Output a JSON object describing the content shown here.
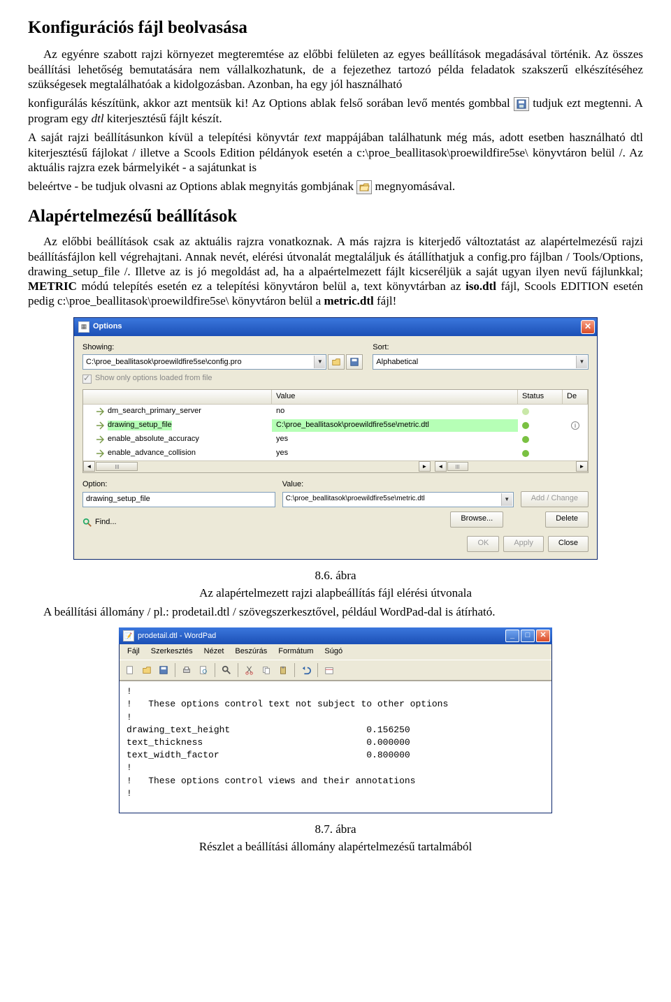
{
  "doc": {
    "h1": "Konfigurációs fájl beolvasása",
    "p1a": "Az egyénre szabott rajzi környezet megteremtése az előbbi felületen az egyes beállítások megadásával történik. Az összes beállítási lehetőség bemutatására nem vállalkozhatunk, de a fejezethez tartozó példa feladatok szakszerű elkészítéséhez szükségesek megtalálhatóak a kidolgozásban. Azonban, ha egy jól használható",
    "p1b_pre": "konfigurálás készítünk, akkor azt mentsük ki! Az Options ablak felső sorában levő mentés gombbal ",
    "p1b_post": " tudjuk ezt megtenni. A program egy ",
    "p1b_it": "dtl",
    "p1b_end": " kiterjesztésű fájlt készít.",
    "p2_pre": "A saját rajzi beállításunkon kívül a telepítési könyvtár ",
    "p2_it1": "text",
    "p2_mid1": " mappájában találhatunk még más, adott esetben használható dtl kiterjesztésű fájlokat / illetve a Scools Edition példányok esetén a c:\\proe_beallitasok\\proewildfire5se\\ könyvtáron belül /. Az aktuális rajzra ezek bármelyikét - a sajátunkat is",
    "p3_pre": "beleértve - be tudjuk olvasni az Options ablak megnyitás gombjának ",
    "p3_post": " megnyomásával.",
    "h2": "Alapértelmezésű beállítások",
    "p4_pre": "Az előbbi beállítások csak az aktuális rajzra vonatkoznak. A más rajzra is kiterjedő változtatást az alapértelmezésű rajzi beállításfájlon kell végrehajtani. Annak nevét, elérési útvonalát megtaláljuk és átállíthatjuk a config.pro fájlban / Tools/Options, drawing_setup_file /. Illetve az is jó megoldást ad, ha a alpaértelmezett fájlt kicseréljük a saját ugyan ilyen nevű fájlunkkal; ",
    "p4_b1": "METRIC",
    "p4_mid1": " módú telepítés esetén ez a telepítési könyvtáron belül a, text könyvtárban az ",
    "p4_b2": "iso.dtl",
    "p4_mid2": " fájl, Scools EDITION esetén pedig c:\\proe_beallitasok\\proewildfire5se\\ könyvtáron belül a ",
    "p4_b3": "metric.dtl",
    "p4_end": " fájl!",
    "fig1_num": "8.6. ábra",
    "fig1_cap": "Az alapértelmezett rajzi alapbeállítás fájl elérési útvonala",
    "p5": "A beállítási állomány / pl.: prodetail.dtl / szövegszerkesztővel, például WordPad-dal is átírható.",
    "fig2_num": "8.7. ábra",
    "fig2_cap": "Részlet a beállítási állomány alapértelmezésű tartalmából"
  },
  "options": {
    "title": "Options",
    "showing_lbl": "Showing:",
    "showing_val": "C:\\proe_beallitasok\\proewildfire5se\\config.pro",
    "sort_lbl": "Sort:",
    "sort_val": "Alphabetical",
    "show_only": "Show only options loaded from file",
    "cols": {
      "c1": "",
      "c2": "Value",
      "c3": "Status",
      "c4": "De"
    },
    "rows": [
      {
        "name": "dm_search_primary_server",
        "value": "no",
        "dot": "light",
        "info": false
      },
      {
        "name": "drawing_setup_file",
        "value": "C:\\proe_beallitasok\\proewildfire5se\\metric.dtl",
        "dot": "dark",
        "info": true,
        "selected": true
      },
      {
        "name": "enable_absolute_accuracy",
        "value": "yes",
        "dot": "dark",
        "info": false
      },
      {
        "name": "enable_advance_collision",
        "value": "yes",
        "dot": "dark",
        "info": false
      }
    ],
    "option_lbl": "Option:",
    "option_val": "drawing_setup_file",
    "value_lbl": "Value:",
    "value_val": "C:\\proe_beallitasok\\proewildfire5se\\metric.dtl",
    "addchange": "Add / Change",
    "find": "Find...",
    "browse": "Browse...",
    "delete": "Delete",
    "ok": "OK",
    "apply": "Apply",
    "close": "Close"
  },
  "wordpad": {
    "title": "prodetail.dtl - WordPad",
    "menus": [
      "Fájl",
      "Szerkesztés",
      "Nézet",
      "Beszúrás",
      "Formátum",
      "Súgó"
    ],
    "content_lines": [
      "!",
      "!   These options control text not subject to other options",
      "!",
      "drawing_text_height                         0.156250",
      "text_thickness                              0.000000",
      "text_width_factor                           0.800000",
      "!",
      "!   These options control views and their annotations",
      "!"
    ]
  }
}
